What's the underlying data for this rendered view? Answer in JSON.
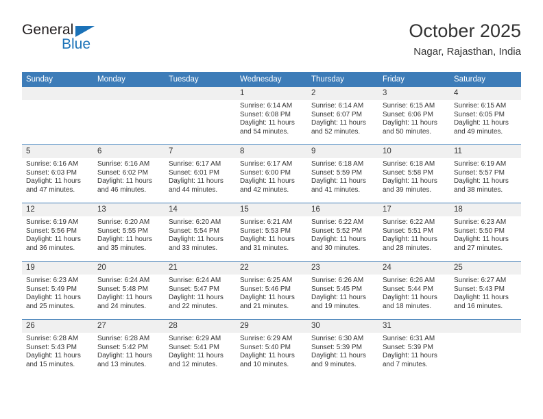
{
  "brand": {
    "name_part1": "General",
    "name_part2": "Blue",
    "triangle_color": "#1b72b8"
  },
  "header": {
    "title": "October 2025",
    "subtitle": "Nagar, Rajasthan, India"
  },
  "theme": {
    "header_bg": "#3d7cb8",
    "daynum_bg": "#f0f0f0",
    "text": "#333333",
    "accent": "#1b72b8"
  },
  "weekdays": [
    "Sunday",
    "Monday",
    "Tuesday",
    "Wednesday",
    "Thursday",
    "Friday",
    "Saturday"
  ],
  "weeks": [
    [
      {
        "day": "",
        "sunrise": "",
        "sunset": "",
        "daylight": ""
      },
      {
        "day": "",
        "sunrise": "",
        "sunset": "",
        "daylight": ""
      },
      {
        "day": "",
        "sunrise": "",
        "sunset": "",
        "daylight": ""
      },
      {
        "day": "1",
        "sunrise": "Sunrise: 6:14 AM",
        "sunset": "Sunset: 6:08 PM",
        "daylight": "Daylight: 11 hours and 54 minutes."
      },
      {
        "day": "2",
        "sunrise": "Sunrise: 6:14 AM",
        "sunset": "Sunset: 6:07 PM",
        "daylight": "Daylight: 11 hours and 52 minutes."
      },
      {
        "day": "3",
        "sunrise": "Sunrise: 6:15 AM",
        "sunset": "Sunset: 6:06 PM",
        "daylight": "Daylight: 11 hours and 50 minutes."
      },
      {
        "day": "4",
        "sunrise": "Sunrise: 6:15 AM",
        "sunset": "Sunset: 6:05 PM",
        "daylight": "Daylight: 11 hours and 49 minutes."
      }
    ],
    [
      {
        "day": "5",
        "sunrise": "Sunrise: 6:16 AM",
        "sunset": "Sunset: 6:03 PM",
        "daylight": "Daylight: 11 hours and 47 minutes."
      },
      {
        "day": "6",
        "sunrise": "Sunrise: 6:16 AM",
        "sunset": "Sunset: 6:02 PM",
        "daylight": "Daylight: 11 hours and 46 minutes."
      },
      {
        "day": "7",
        "sunrise": "Sunrise: 6:17 AM",
        "sunset": "Sunset: 6:01 PM",
        "daylight": "Daylight: 11 hours and 44 minutes."
      },
      {
        "day": "8",
        "sunrise": "Sunrise: 6:17 AM",
        "sunset": "Sunset: 6:00 PM",
        "daylight": "Daylight: 11 hours and 42 minutes."
      },
      {
        "day": "9",
        "sunrise": "Sunrise: 6:18 AM",
        "sunset": "Sunset: 5:59 PM",
        "daylight": "Daylight: 11 hours and 41 minutes."
      },
      {
        "day": "10",
        "sunrise": "Sunrise: 6:18 AM",
        "sunset": "Sunset: 5:58 PM",
        "daylight": "Daylight: 11 hours and 39 minutes."
      },
      {
        "day": "11",
        "sunrise": "Sunrise: 6:19 AM",
        "sunset": "Sunset: 5:57 PM",
        "daylight": "Daylight: 11 hours and 38 minutes."
      }
    ],
    [
      {
        "day": "12",
        "sunrise": "Sunrise: 6:19 AM",
        "sunset": "Sunset: 5:56 PM",
        "daylight": "Daylight: 11 hours and 36 minutes."
      },
      {
        "day": "13",
        "sunrise": "Sunrise: 6:20 AM",
        "sunset": "Sunset: 5:55 PM",
        "daylight": "Daylight: 11 hours and 35 minutes."
      },
      {
        "day": "14",
        "sunrise": "Sunrise: 6:20 AM",
        "sunset": "Sunset: 5:54 PM",
        "daylight": "Daylight: 11 hours and 33 minutes."
      },
      {
        "day": "15",
        "sunrise": "Sunrise: 6:21 AM",
        "sunset": "Sunset: 5:53 PM",
        "daylight": "Daylight: 11 hours and 31 minutes."
      },
      {
        "day": "16",
        "sunrise": "Sunrise: 6:22 AM",
        "sunset": "Sunset: 5:52 PM",
        "daylight": "Daylight: 11 hours and 30 minutes."
      },
      {
        "day": "17",
        "sunrise": "Sunrise: 6:22 AM",
        "sunset": "Sunset: 5:51 PM",
        "daylight": "Daylight: 11 hours and 28 minutes."
      },
      {
        "day": "18",
        "sunrise": "Sunrise: 6:23 AM",
        "sunset": "Sunset: 5:50 PM",
        "daylight": "Daylight: 11 hours and 27 minutes."
      }
    ],
    [
      {
        "day": "19",
        "sunrise": "Sunrise: 6:23 AM",
        "sunset": "Sunset: 5:49 PM",
        "daylight": "Daylight: 11 hours and 25 minutes."
      },
      {
        "day": "20",
        "sunrise": "Sunrise: 6:24 AM",
        "sunset": "Sunset: 5:48 PM",
        "daylight": "Daylight: 11 hours and 24 minutes."
      },
      {
        "day": "21",
        "sunrise": "Sunrise: 6:24 AM",
        "sunset": "Sunset: 5:47 PM",
        "daylight": "Daylight: 11 hours and 22 minutes."
      },
      {
        "day": "22",
        "sunrise": "Sunrise: 6:25 AM",
        "sunset": "Sunset: 5:46 PM",
        "daylight": "Daylight: 11 hours and 21 minutes."
      },
      {
        "day": "23",
        "sunrise": "Sunrise: 6:26 AM",
        "sunset": "Sunset: 5:45 PM",
        "daylight": "Daylight: 11 hours and 19 minutes."
      },
      {
        "day": "24",
        "sunrise": "Sunrise: 6:26 AM",
        "sunset": "Sunset: 5:44 PM",
        "daylight": "Daylight: 11 hours and 18 minutes."
      },
      {
        "day": "25",
        "sunrise": "Sunrise: 6:27 AM",
        "sunset": "Sunset: 5:43 PM",
        "daylight": "Daylight: 11 hours and 16 minutes."
      }
    ],
    [
      {
        "day": "26",
        "sunrise": "Sunrise: 6:28 AM",
        "sunset": "Sunset: 5:43 PM",
        "daylight": "Daylight: 11 hours and 15 minutes."
      },
      {
        "day": "27",
        "sunrise": "Sunrise: 6:28 AM",
        "sunset": "Sunset: 5:42 PM",
        "daylight": "Daylight: 11 hours and 13 minutes."
      },
      {
        "day": "28",
        "sunrise": "Sunrise: 6:29 AM",
        "sunset": "Sunset: 5:41 PM",
        "daylight": "Daylight: 11 hours and 12 minutes."
      },
      {
        "day": "29",
        "sunrise": "Sunrise: 6:29 AM",
        "sunset": "Sunset: 5:40 PM",
        "daylight": "Daylight: 11 hours and 10 minutes."
      },
      {
        "day": "30",
        "sunrise": "Sunrise: 6:30 AM",
        "sunset": "Sunset: 5:39 PM",
        "daylight": "Daylight: 11 hours and 9 minutes."
      },
      {
        "day": "31",
        "sunrise": "Sunrise: 6:31 AM",
        "sunset": "Sunset: 5:39 PM",
        "daylight": "Daylight: 11 hours and 7 minutes."
      },
      {
        "day": "",
        "sunrise": "",
        "sunset": "",
        "daylight": ""
      }
    ]
  ]
}
